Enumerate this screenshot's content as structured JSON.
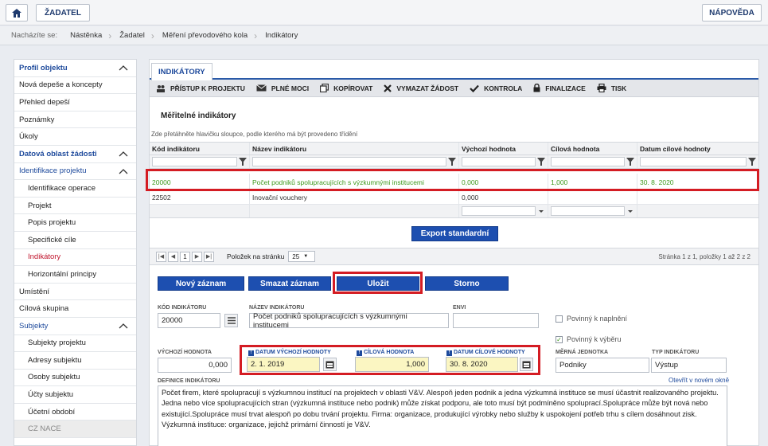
{
  "topbar": {
    "zadatel": "ŽADATEL",
    "help": "NÁPOVĚDA"
  },
  "breadcrumb": {
    "label": "Nacházíte se:",
    "items": [
      "Nástěnka",
      "Žadatel",
      "Měření převodového kola",
      "Indikátory"
    ]
  },
  "sidebar": {
    "items": [
      {
        "label": "Profil objektu"
      },
      {
        "label": "Nová depeše a koncepty"
      },
      {
        "label": "Přehled depeší"
      },
      {
        "label": "Poznámky"
      },
      {
        "label": "Úkoly"
      },
      {
        "label": "Datová oblast žádosti"
      },
      {
        "label": "Identifikace projektu"
      },
      {
        "label": "Identifikace operace"
      },
      {
        "label": "Projekt"
      },
      {
        "label": "Popis projektu"
      },
      {
        "label": "Specifické cíle"
      },
      {
        "label": "Indikátory"
      },
      {
        "label": "Horizontální principy"
      },
      {
        "label": "Umístění"
      },
      {
        "label": "Cílová skupina"
      },
      {
        "label": "Subjekty"
      },
      {
        "label": "Subjekty projektu"
      },
      {
        "label": "Adresy subjektu"
      },
      {
        "label": "Osoby subjektu"
      },
      {
        "label": "Účty subjektu"
      },
      {
        "label": "Účetní období"
      },
      {
        "label": "CZ NACE"
      }
    ]
  },
  "main": {
    "tab": "INDIKÁTORY",
    "toolbar": [
      "PŘÍSTUP K PROJEKTU",
      "PLNÉ MOCI",
      "KOPÍROVAT",
      "VYMAZAT ŽÁDOST",
      "KONTROLA",
      "FINALIZACE",
      "TISK"
    ],
    "section_title": "Měřitelné indikátory",
    "sort_hint": "Zde přetáhněte hlavičku sloupce, podle kterého má být provedeno třídění",
    "columns": [
      "Kód indikátoru",
      "Název indikátoru",
      "Výchozí hodnota",
      "Cílová hodnota",
      "Datum cílové hodnoty"
    ],
    "rows": [
      [
        "20000",
        "Počet podniků spolupracujících s výzkumnými institucemi",
        "0,000",
        "1,000",
        "30. 8. 2020"
      ],
      [
        "22502",
        "Inovační vouchery",
        "0,000",
        "",
        ""
      ]
    ],
    "export": "Export standardní",
    "pager": {
      "current": "1",
      "per_page_label": "Položek na stránku",
      "per_page": "25",
      "info": "Stránka 1 z 1, položky 1 až 2 z 2"
    },
    "buttons": {
      "new": "Nový záznam",
      "delete": "Smazat záznam",
      "save": "Uložit",
      "cancel": "Storno"
    }
  },
  "form": {
    "kod_label": "KÓD INDIKÁTORU",
    "kod": "20000",
    "nazev_label": "NÁZEV INDIKÁTORU",
    "nazev": "Počet podniků spolupracujících s výzkumnými institucemi",
    "envi_label": "ENVI",
    "envi": "",
    "povinny_naplneni": "Povinný k naplnění",
    "povinny_vyberu": "Povinný k výběru",
    "vychozi_label": "VÝCHOZÍ HODNOTA",
    "vychozi": "0,000",
    "datum_vychozi_label": "DATUM VÝCHOZÍ HODNOTY",
    "datum_vychozi": "2. 1. 2019",
    "cilova_label": "CÍLOVÁ HODNOTA",
    "cilova": "1,000",
    "datum_cilove_label": "DATUM CÍLOVÉ HODNOTY",
    "datum_cilove": "30. 8. 2020",
    "merna_label": "MĚRNÁ JEDNOTKA",
    "merna": "Podniky",
    "typ_label": "TYP INDIKÁTORU",
    "typ": "Výstup",
    "open_link": "Otevřít v novém okně",
    "definice_label": "DEFINICE INDIKÁTORU",
    "definice": "Počet firem, které spolupracují s výzkumnou institucí na projektech v oblasti V&V. Alespoň jeden podnik a jedna výzkumná instituce se musí účastnit realizovaného projektu. Jedna nebo více spolupracujících stran (výzkumná instituce nebo podnik) může získat podporu, ale toto musí být podmíněno spoluprací.Spolupráce může být nová nebo existující.Spolupráce musí trvat alespoň po dobu trvání projektu. Firma: organizace, produkující výrobky nebo služby k uspokojení potřeb trhu s cílem dosáhnout zisk. Výzkumná instituce: organizace, jejichž primární činností je V&V."
  },
  "colors": {
    "accent": "#1d4fb0",
    "highlight": "#d41c23",
    "green": "#3f9a1e",
    "yellow": "#fbf6c2"
  }
}
